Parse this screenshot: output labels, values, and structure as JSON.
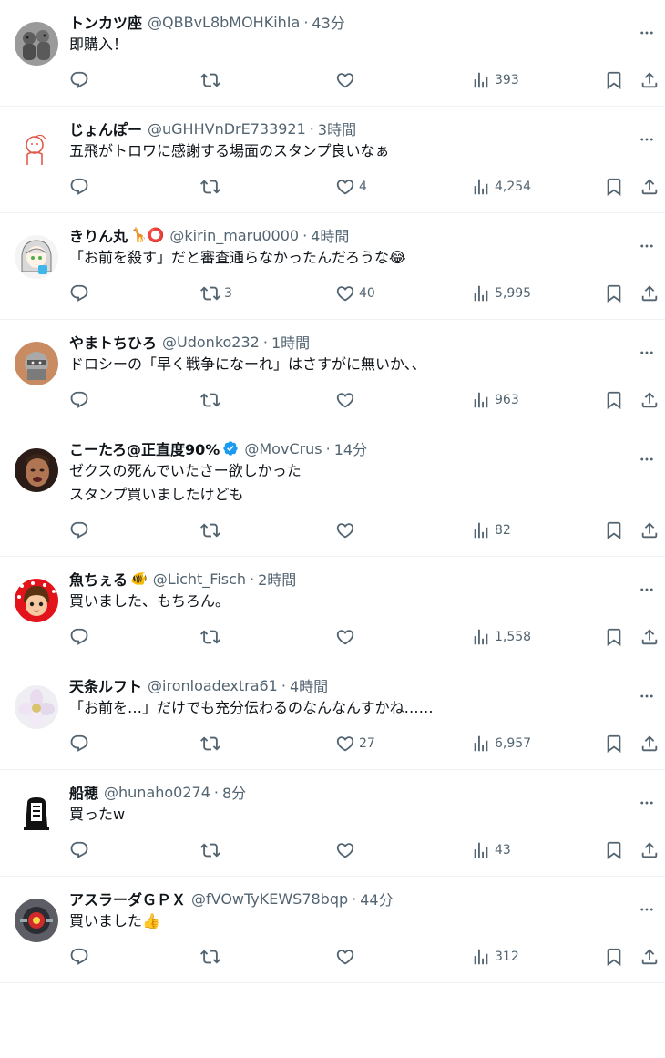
{
  "colors": {
    "text": "#0f1419",
    "secondary": "#536471",
    "divider": "#eff3f4",
    "verified": "#1d9bf0"
  },
  "tweets": [
    {
      "name": "トンカツ座",
      "handle": "@QBBvL8bMOHKihIa",
      "time": "43分",
      "lines": [
        "即購入！"
      ],
      "retweets": "",
      "likes": "",
      "views": "393",
      "avatar": "figurines",
      "name_emoji": "",
      "verified": false
    },
    {
      "name": "じょんぽー",
      "handle": "@uGHHVnDrE733921",
      "time": "3時間",
      "lines": [
        "五飛がトロワに感謝する場面のスタンプ良いなぁ"
      ],
      "retweets": "",
      "likes": "4",
      "views": "4,254",
      "avatar": "doodle",
      "name_emoji": "",
      "verified": false
    },
    {
      "name": "きりん丸",
      "handle": "@kirin_maru0000",
      "time": "4時間",
      "lines": [
        "「お前を殺す」だと審査通らなかったんだろうな😂"
      ],
      "retweets": "3",
      "likes": "40",
      "views": "5,995",
      "avatar": "anime-girl",
      "name_emoji": "🦒⭕",
      "verified": false
    },
    {
      "name": "やまトちひろ",
      "handle": "@Udonko232",
      "time": "1時間",
      "lines": [
        "ドロシーの「早く戦争になーれ」はさすがに無いか、、"
      ],
      "retweets": "",
      "likes": "",
      "views": "963",
      "avatar": "knight",
      "name_emoji": "",
      "verified": false
    },
    {
      "name": "こーたろ@正直度90%",
      "handle": "@MovCrus",
      "time": "14分",
      "lines": [
        "ゼクスの死んでいたさー欲しかった",
        "スタンプ買いましたけども"
      ],
      "retweets": "",
      "likes": "",
      "views": "82",
      "avatar": "man-face",
      "name_emoji": "",
      "verified": true
    },
    {
      "name": "魚ちぇる",
      "handle": "@Licht_Fisch",
      "time": "2時間",
      "lines": [
        "買いました、もちろん。"
      ],
      "retweets": "",
      "likes": "",
      "views": "1,558",
      "avatar": "polka-boy",
      "name_emoji": "🐠",
      "verified": false
    },
    {
      "name": "天条ルフト",
      "handle": "@ironloadextra61",
      "time": "4時間",
      "lines": [
        "「お前を…」だけでも充分伝わるのなんなんすかね……"
      ],
      "retweets": "",
      "likes": "27",
      "views": "6,957",
      "avatar": "flower",
      "name_emoji": "",
      "verified": false
    },
    {
      "name": "船穂",
      "handle": "@hunaho0274",
      "time": "8分",
      "lines": [
        "買ったw"
      ],
      "retweets": "",
      "likes": "",
      "views": "43",
      "avatar": "bell",
      "name_emoji": "",
      "verified": false
    },
    {
      "name": "アスラーダＧＰＸ",
      "handle": "@fVOwTyKEWS78bqp",
      "time": "44分",
      "lines": [
        "買いました👍"
      ],
      "retweets": "",
      "likes": "",
      "views": "312",
      "avatar": "robot",
      "name_emoji": "",
      "verified": false
    }
  ]
}
